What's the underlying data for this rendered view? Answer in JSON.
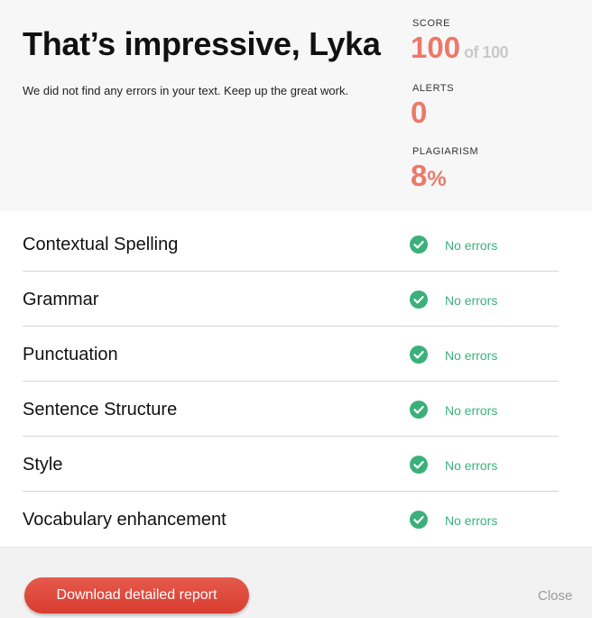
{
  "header": {
    "headline": "That’s impressive, Lyka",
    "subtext": "We did not find any errors in your text. Keep up the great work."
  },
  "stats": {
    "score_label": "SCORE",
    "score_value": "100",
    "score_of": "of 100",
    "alerts_label": "ALERTS",
    "alerts_value": "0",
    "plagiarism_label": "PLAGIARISM",
    "plagiarism_value": "8",
    "plagiarism_unit": "%"
  },
  "checks": [
    {
      "label": "Contextual Spelling",
      "status": "No errors"
    },
    {
      "label": "Grammar",
      "status": "No errors"
    },
    {
      "label": "Punctuation",
      "status": "No errors"
    },
    {
      "label": "Sentence Structure",
      "status": "No errors"
    },
    {
      "label": "Style",
      "status": "No errors"
    },
    {
      "label": "Vocabulary enhancement",
      "status": "No errors"
    }
  ],
  "footer": {
    "download_label": "Download detailed report",
    "close_label": "Close"
  },
  "colors": {
    "accent": "#ea7a6a",
    "success": "#3bb07b",
    "button": "#d93c30"
  },
  "icons": {
    "check": "check-circle-icon"
  }
}
